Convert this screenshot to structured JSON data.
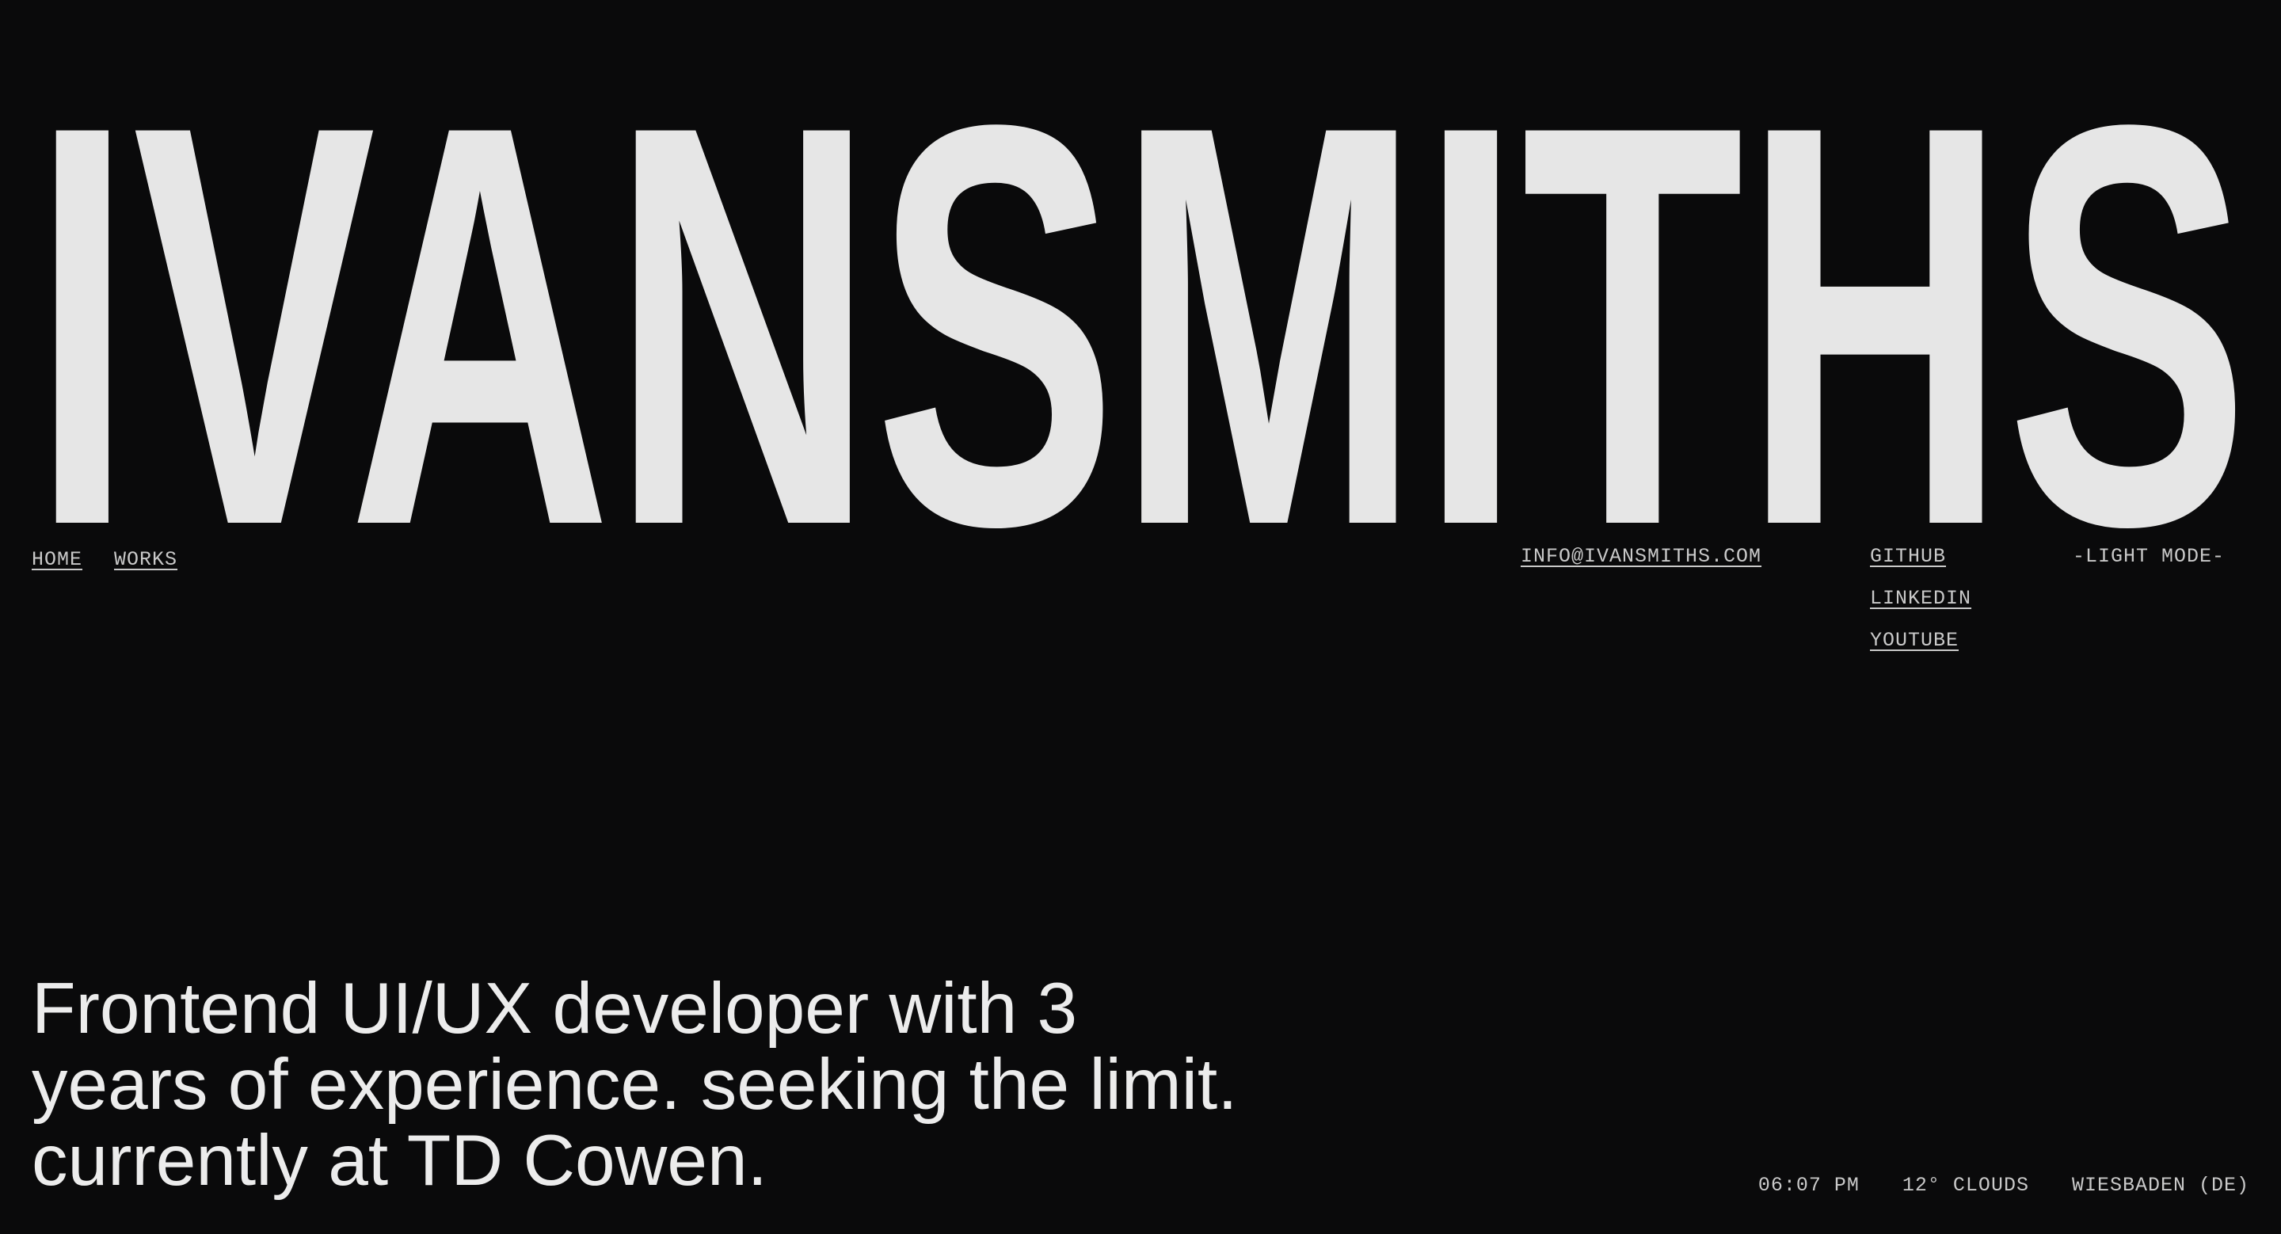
{
  "brand": {
    "wordmark": "IVANSMITHS"
  },
  "nav": {
    "items": [
      {
        "label": "HOME"
      },
      {
        "label": "WORKS"
      }
    ]
  },
  "contact": {
    "email": "INFO@IVANSMITHS.COM"
  },
  "socials": {
    "items": [
      {
        "label": "GITHUB"
      },
      {
        "label": "LINKEDIN"
      },
      {
        "label": "YOUTUBE"
      }
    ]
  },
  "theme_toggle": {
    "label": "-LIGHT MODE-"
  },
  "hero": {
    "tagline_lines": [
      "Frontend UI/UX developer with 3",
      "years of experience. seeking the limit.",
      "currently at TD Cowen."
    ]
  },
  "status": {
    "time": "06:07 PM",
    "weather": "12° CLOUDS",
    "location": "WIESBADEN (DE)"
  },
  "colors": {
    "background": "#0a0a0b",
    "wordmark": "#e6e6e6",
    "text": "#e7e7e7",
    "muted": "#c9c9c9"
  }
}
